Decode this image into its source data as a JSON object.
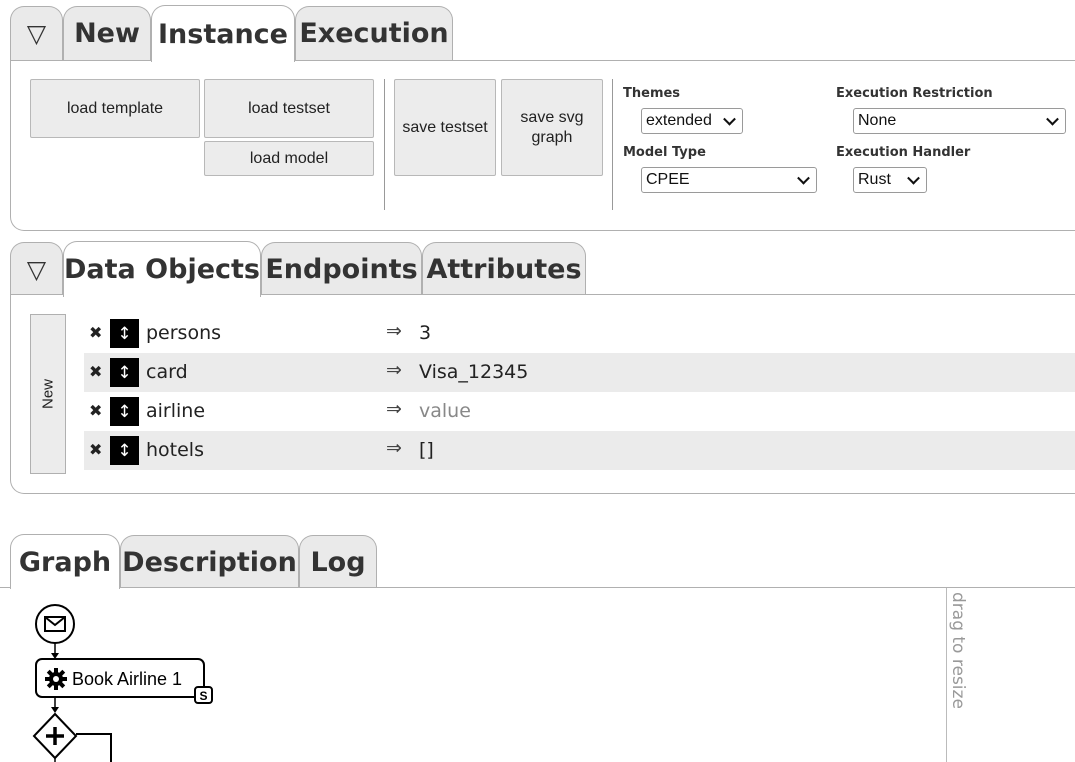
{
  "top_tabs": {
    "toggle": "▽",
    "items": [
      "New",
      "Instance",
      "Execution"
    ],
    "active": "Instance"
  },
  "instance": {
    "buttons": {
      "load_template": "load template",
      "load_testset": "load testset",
      "load_model": "load model",
      "save_testset": "save testset",
      "save_svg_graph": "save svg graph"
    },
    "themes": {
      "label": "Themes",
      "value": "extended"
    },
    "model_type": {
      "label": "Model Type",
      "value": "CPEE"
    },
    "execution_restriction": {
      "label": "Execution Restriction",
      "value": "None"
    },
    "execution_handler": {
      "label": "Execution Handler",
      "value": "Rust"
    }
  },
  "data_tabs": {
    "toggle": "▽",
    "items": [
      "Data Objects",
      "Endpoints",
      "Attributes"
    ],
    "active": "Data Objects"
  },
  "data_objects": {
    "new_label": "New",
    "arrow": "⇒",
    "rows": [
      {
        "key": "persons",
        "value": "3",
        "placeholder": false
      },
      {
        "key": "card",
        "value": "Visa_12345",
        "placeholder": false
      },
      {
        "key": "airline",
        "value": "value",
        "placeholder": true
      },
      {
        "key": "hotels",
        "value": "[]",
        "placeholder": false
      }
    ]
  },
  "graph_tabs": {
    "items": [
      "Graph",
      "Description",
      "Log"
    ],
    "active": "Graph"
  },
  "graph": {
    "task_label": "Book Airline 1",
    "task_badge": "S",
    "resize_label": "drag to resize"
  }
}
